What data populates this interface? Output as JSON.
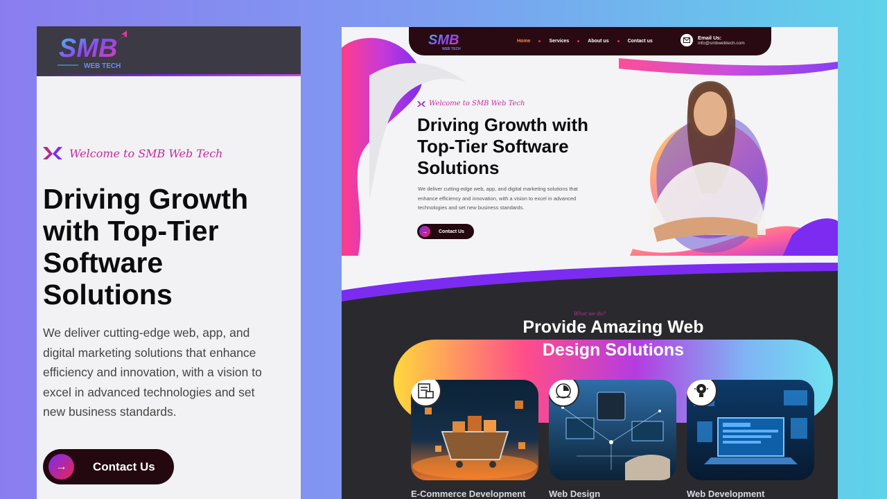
{
  "brand": {
    "logo_text": "SMB",
    "logo_sub": "WEB TECH"
  },
  "mobile": {
    "welcome": "Welcome to SMB Web Tech",
    "title": "Driving Growth with Top-Tier Software Solutions",
    "description": "We deliver cutting-edge web, app, and digital marketing solutions that enhance efficiency and innovation, with a vision to excel in advanced technologies and set new business standards.",
    "cta": "Contact Us"
  },
  "desktop": {
    "nav": {
      "links": [
        "Home",
        "Services",
        "About us",
        "Contact us"
      ],
      "active": "Home",
      "email_label": "Email Us:",
      "email_value": "info@smbwebtech.com"
    },
    "hero": {
      "welcome": "Welcome to SMB Web Tech",
      "title": "Driving Growth with Top-Tier Software Solutions",
      "description": "We deliver cutting-edge web, app, and digital marketing solutions that enhance efficiency and innovation, with a vision to excel in advanced technologies and set new business standards.",
      "cta": "Contact Us"
    },
    "services": {
      "kicker": "What we do?",
      "title_line1": "Provide Amazing Web",
      "title_line2": "Design Solutions",
      "cards": [
        {
          "label": "E-Commerce Development",
          "icon": "ecommerce-icon"
        },
        {
          "label": "Web Design",
          "icon": "web-design-icon"
        },
        {
          "label": "Web Development",
          "icon": "bulb-gear-icon"
        }
      ]
    }
  },
  "colors": {
    "accent_pink": "#e8254f",
    "accent_purple": "#7b2cf0",
    "dark": "#24080f",
    "bg_cyan": "#5fd3ea"
  }
}
